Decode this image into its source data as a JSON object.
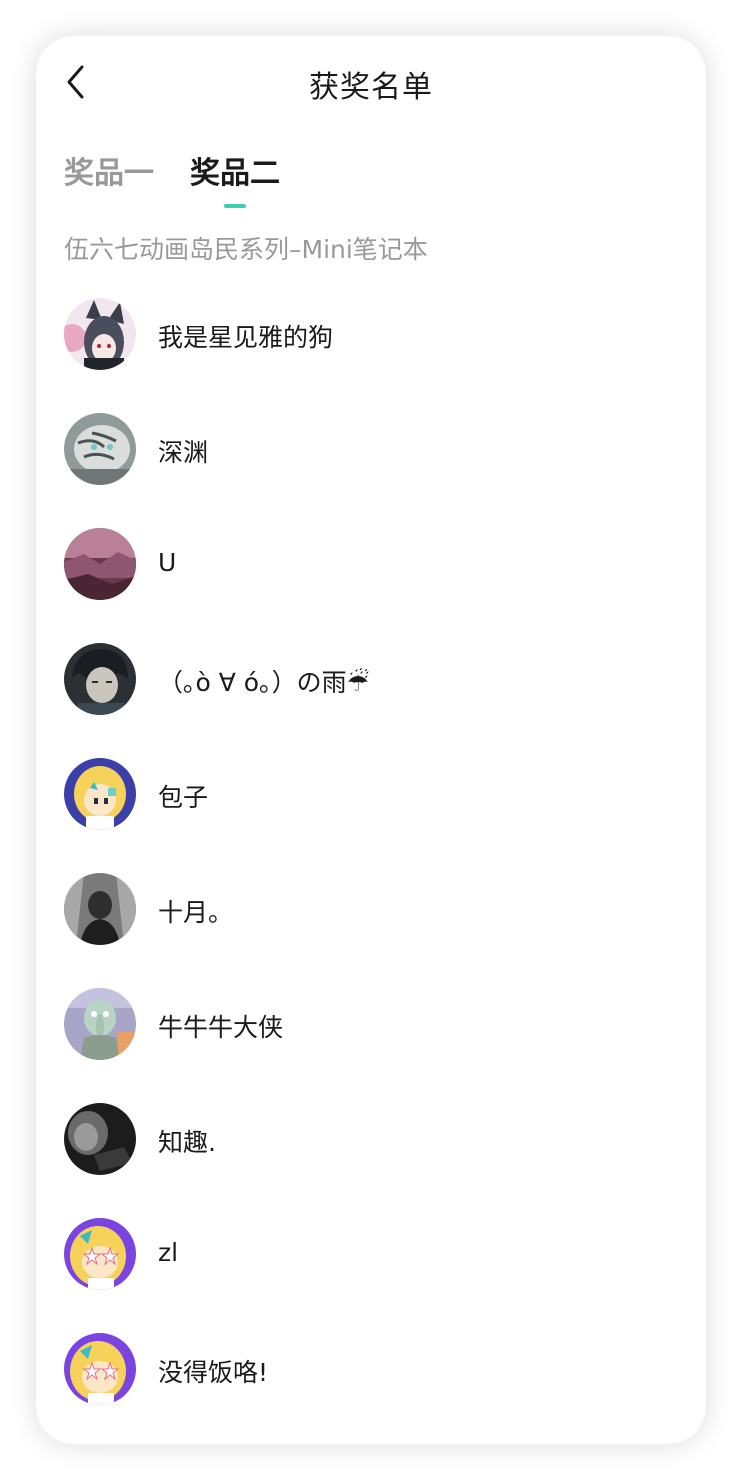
{
  "header": {
    "title": "获奖名单",
    "back_icon": "chevron-left-icon"
  },
  "tabs": [
    {
      "label": "奖品一",
      "active": false
    },
    {
      "label": "奖品二",
      "active": true
    }
  ],
  "accent_color": "#3ccfb4",
  "prize_name": "伍六七动画岛民系列–Mini笔记本",
  "winners": [
    {
      "name": "我是星见雅的狗",
      "avatar": "anime-girl-wolf-ears-avatar"
    },
    {
      "name": "深渊",
      "avatar": "white-tiger-avatar"
    },
    {
      "name": "U",
      "avatar": "pink-rock-landscape-avatar"
    },
    {
      "name": "（｡ò ∀ ó｡）の雨☔",
      "avatar": "dark-haired-anime-avatar"
    },
    {
      "name": "包子",
      "avatar": "blonde-cartoon-girl-avatar"
    },
    {
      "name": "十月。",
      "avatar": "grayscale-photo-avatar"
    },
    {
      "name": "牛牛牛大侠",
      "avatar": "squidward-avatar"
    },
    {
      "name": "知趣.",
      "avatar": "dark-photo-avatar"
    },
    {
      "name": "zl",
      "avatar": "default-cartoon-avatar"
    },
    {
      "name": "没得饭咯!",
      "avatar": "default-cartoon-avatar"
    }
  ]
}
